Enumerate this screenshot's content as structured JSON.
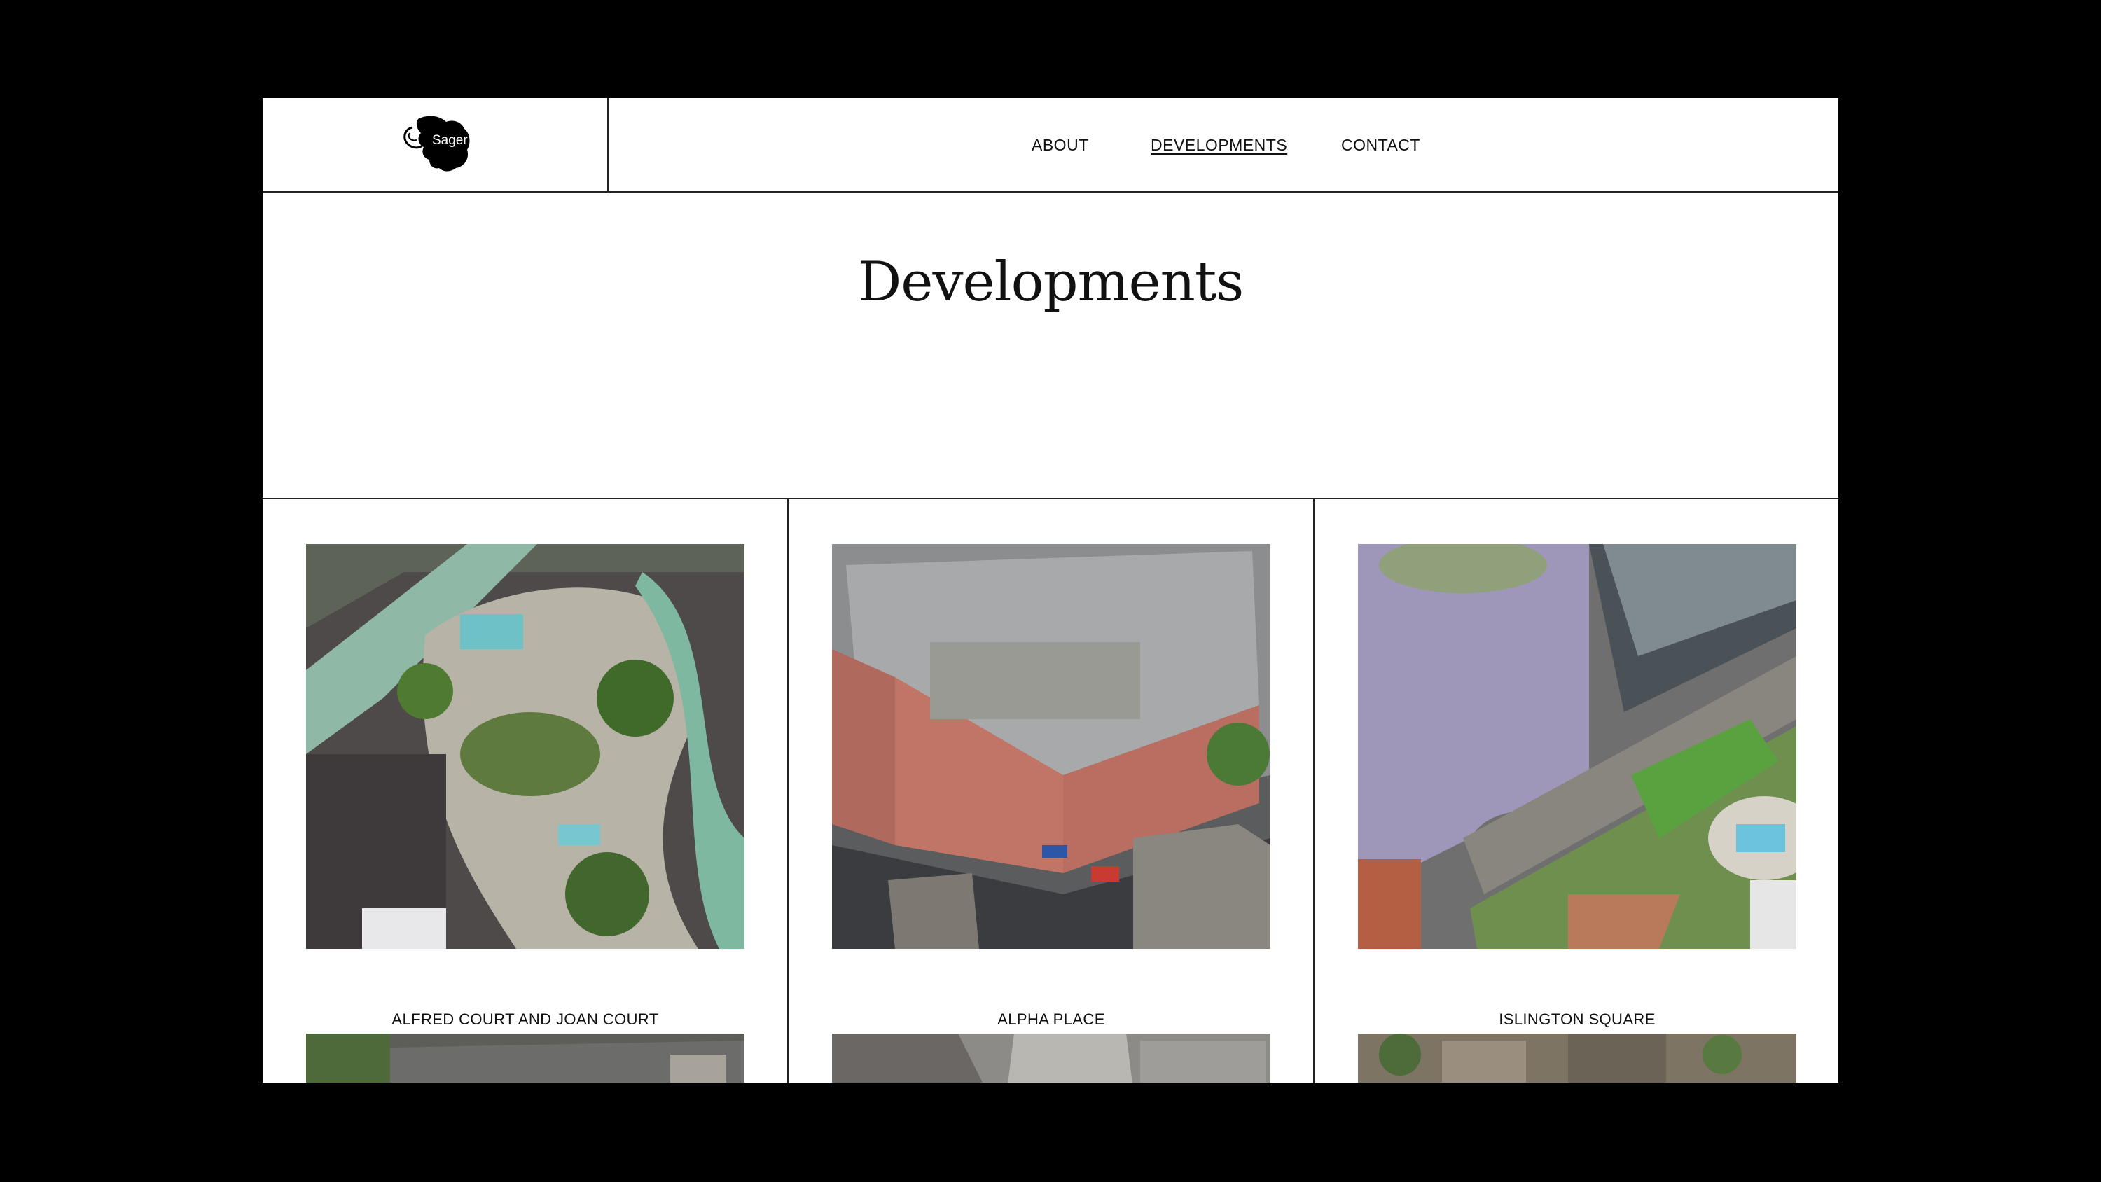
{
  "brand": {
    "logo_text": "Sager"
  },
  "nav": {
    "items": [
      {
        "label": "ABOUT",
        "active": false
      },
      {
        "label": "DEVELOPMENTS",
        "active": true
      },
      {
        "label": "CONTACT",
        "active": false
      }
    ]
  },
  "page": {
    "title": "Developments"
  },
  "developments": [
    {
      "name": "ALFRED COURT AND JOAN COURT"
    },
    {
      "name": "ALPHA PLACE"
    },
    {
      "name": "ISLINGTON SQUARE"
    }
  ],
  "colors": {
    "background": "#000000",
    "panel": "#ffffff",
    "rule": "#222222",
    "text": "#111111"
  }
}
